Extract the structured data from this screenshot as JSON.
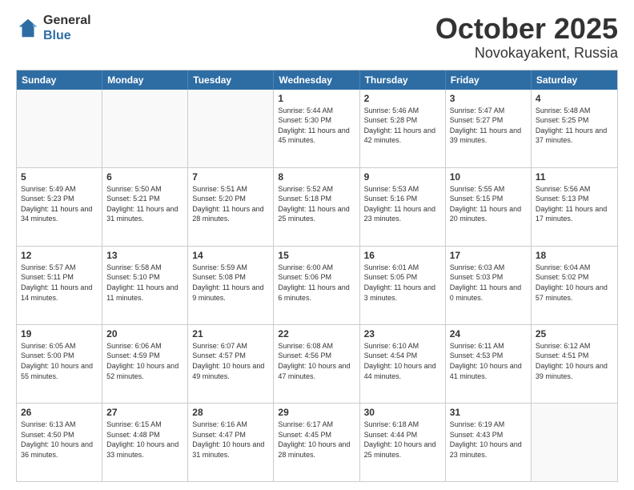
{
  "header": {
    "logo_general": "General",
    "logo_blue": "Blue",
    "title": "October 2025",
    "subtitle": "Novokayakent, Russia"
  },
  "days_of_week": [
    "Sunday",
    "Monday",
    "Tuesday",
    "Wednesday",
    "Thursday",
    "Friday",
    "Saturday"
  ],
  "weeks": [
    [
      {
        "day": "",
        "sunrise": "",
        "sunset": "",
        "daylight": "",
        "empty": true
      },
      {
        "day": "",
        "sunrise": "",
        "sunset": "",
        "daylight": "",
        "empty": true
      },
      {
        "day": "",
        "sunrise": "",
        "sunset": "",
        "daylight": "",
        "empty": true
      },
      {
        "day": "1",
        "sunrise": "Sunrise: 5:44 AM",
        "sunset": "Sunset: 5:30 PM",
        "daylight": "Daylight: 11 hours and 45 minutes."
      },
      {
        "day": "2",
        "sunrise": "Sunrise: 5:46 AM",
        "sunset": "Sunset: 5:28 PM",
        "daylight": "Daylight: 11 hours and 42 minutes."
      },
      {
        "day": "3",
        "sunrise": "Sunrise: 5:47 AM",
        "sunset": "Sunset: 5:27 PM",
        "daylight": "Daylight: 11 hours and 39 minutes."
      },
      {
        "day": "4",
        "sunrise": "Sunrise: 5:48 AM",
        "sunset": "Sunset: 5:25 PM",
        "daylight": "Daylight: 11 hours and 37 minutes."
      }
    ],
    [
      {
        "day": "5",
        "sunrise": "Sunrise: 5:49 AM",
        "sunset": "Sunset: 5:23 PM",
        "daylight": "Daylight: 11 hours and 34 minutes."
      },
      {
        "day": "6",
        "sunrise": "Sunrise: 5:50 AM",
        "sunset": "Sunset: 5:21 PM",
        "daylight": "Daylight: 11 hours and 31 minutes."
      },
      {
        "day": "7",
        "sunrise": "Sunrise: 5:51 AM",
        "sunset": "Sunset: 5:20 PM",
        "daylight": "Daylight: 11 hours and 28 minutes."
      },
      {
        "day": "8",
        "sunrise": "Sunrise: 5:52 AM",
        "sunset": "Sunset: 5:18 PM",
        "daylight": "Daylight: 11 hours and 25 minutes."
      },
      {
        "day": "9",
        "sunrise": "Sunrise: 5:53 AM",
        "sunset": "Sunset: 5:16 PM",
        "daylight": "Daylight: 11 hours and 23 minutes."
      },
      {
        "day": "10",
        "sunrise": "Sunrise: 5:55 AM",
        "sunset": "Sunset: 5:15 PM",
        "daylight": "Daylight: 11 hours and 20 minutes."
      },
      {
        "day": "11",
        "sunrise": "Sunrise: 5:56 AM",
        "sunset": "Sunset: 5:13 PM",
        "daylight": "Daylight: 11 hours and 17 minutes."
      }
    ],
    [
      {
        "day": "12",
        "sunrise": "Sunrise: 5:57 AM",
        "sunset": "Sunset: 5:11 PM",
        "daylight": "Daylight: 11 hours and 14 minutes."
      },
      {
        "day": "13",
        "sunrise": "Sunrise: 5:58 AM",
        "sunset": "Sunset: 5:10 PM",
        "daylight": "Daylight: 11 hours and 11 minutes."
      },
      {
        "day": "14",
        "sunrise": "Sunrise: 5:59 AM",
        "sunset": "Sunset: 5:08 PM",
        "daylight": "Daylight: 11 hours and 9 minutes."
      },
      {
        "day": "15",
        "sunrise": "Sunrise: 6:00 AM",
        "sunset": "Sunset: 5:06 PM",
        "daylight": "Daylight: 11 hours and 6 minutes."
      },
      {
        "day": "16",
        "sunrise": "Sunrise: 6:01 AM",
        "sunset": "Sunset: 5:05 PM",
        "daylight": "Daylight: 11 hours and 3 minutes."
      },
      {
        "day": "17",
        "sunrise": "Sunrise: 6:03 AM",
        "sunset": "Sunset: 5:03 PM",
        "daylight": "Daylight: 11 hours and 0 minutes."
      },
      {
        "day": "18",
        "sunrise": "Sunrise: 6:04 AM",
        "sunset": "Sunset: 5:02 PM",
        "daylight": "Daylight: 10 hours and 57 minutes."
      }
    ],
    [
      {
        "day": "19",
        "sunrise": "Sunrise: 6:05 AM",
        "sunset": "Sunset: 5:00 PM",
        "daylight": "Daylight: 10 hours and 55 minutes."
      },
      {
        "day": "20",
        "sunrise": "Sunrise: 6:06 AM",
        "sunset": "Sunset: 4:59 PM",
        "daylight": "Daylight: 10 hours and 52 minutes."
      },
      {
        "day": "21",
        "sunrise": "Sunrise: 6:07 AM",
        "sunset": "Sunset: 4:57 PM",
        "daylight": "Daylight: 10 hours and 49 minutes."
      },
      {
        "day": "22",
        "sunrise": "Sunrise: 6:08 AM",
        "sunset": "Sunset: 4:56 PM",
        "daylight": "Daylight: 10 hours and 47 minutes."
      },
      {
        "day": "23",
        "sunrise": "Sunrise: 6:10 AM",
        "sunset": "Sunset: 4:54 PM",
        "daylight": "Daylight: 10 hours and 44 minutes."
      },
      {
        "day": "24",
        "sunrise": "Sunrise: 6:11 AM",
        "sunset": "Sunset: 4:53 PM",
        "daylight": "Daylight: 10 hours and 41 minutes."
      },
      {
        "day": "25",
        "sunrise": "Sunrise: 6:12 AM",
        "sunset": "Sunset: 4:51 PM",
        "daylight": "Daylight: 10 hours and 39 minutes."
      }
    ],
    [
      {
        "day": "26",
        "sunrise": "Sunrise: 6:13 AM",
        "sunset": "Sunset: 4:50 PM",
        "daylight": "Daylight: 10 hours and 36 minutes."
      },
      {
        "day": "27",
        "sunrise": "Sunrise: 6:15 AM",
        "sunset": "Sunset: 4:48 PM",
        "daylight": "Daylight: 10 hours and 33 minutes."
      },
      {
        "day": "28",
        "sunrise": "Sunrise: 6:16 AM",
        "sunset": "Sunset: 4:47 PM",
        "daylight": "Daylight: 10 hours and 31 minutes."
      },
      {
        "day": "29",
        "sunrise": "Sunrise: 6:17 AM",
        "sunset": "Sunset: 4:45 PM",
        "daylight": "Daylight: 10 hours and 28 minutes."
      },
      {
        "day": "30",
        "sunrise": "Sunrise: 6:18 AM",
        "sunset": "Sunset: 4:44 PM",
        "daylight": "Daylight: 10 hours and 25 minutes."
      },
      {
        "day": "31",
        "sunrise": "Sunrise: 6:19 AM",
        "sunset": "Sunset: 4:43 PM",
        "daylight": "Daylight: 10 hours and 23 minutes."
      },
      {
        "day": "",
        "sunrise": "",
        "sunset": "",
        "daylight": "",
        "empty": true
      }
    ]
  ]
}
